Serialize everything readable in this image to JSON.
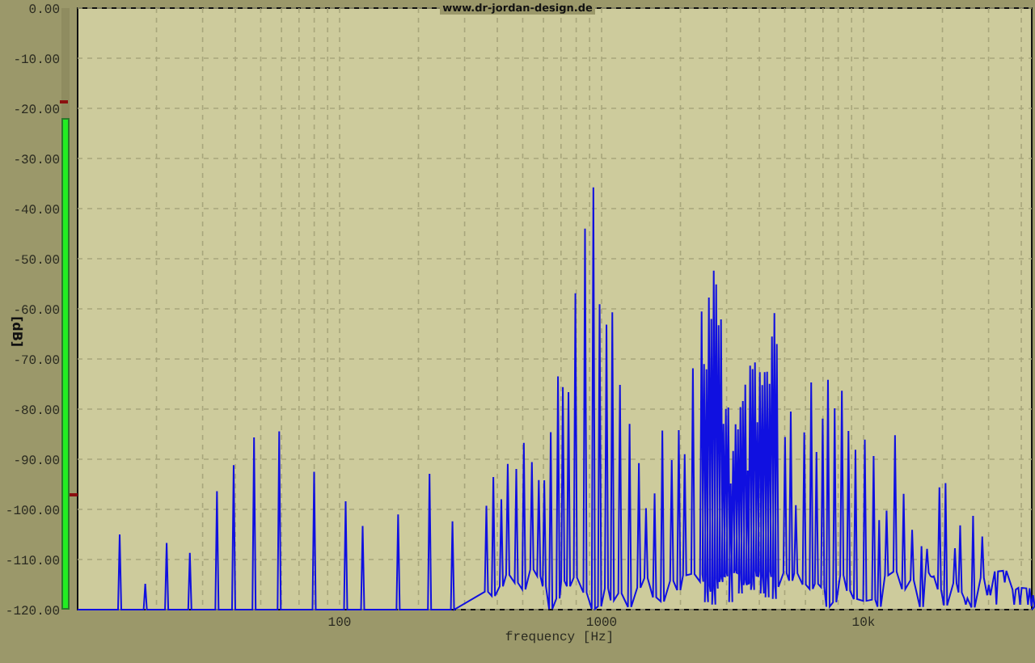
{
  "header_text": "www.dr-jordan-design.de",
  "y_axis": {
    "title": "[dB]",
    "ticks": [
      "0.00",
      "-10.00",
      "-20.00",
      "-30.00",
      "-40.00",
      "-50.00",
      "-60.00",
      "-70.00",
      "-80.00",
      "-90.00",
      "-100.00",
      "-110.00",
      "-120.00"
    ]
  },
  "x_axis": {
    "title": "frequency [Hz]",
    "ticks": [
      "100",
      "1000",
      "10k"
    ]
  },
  "level_meter": {
    "level": 0.817,
    "markers": [
      {
        "level": 0.845
      },
      {
        "level": 0.19
      }
    ]
  }
}
